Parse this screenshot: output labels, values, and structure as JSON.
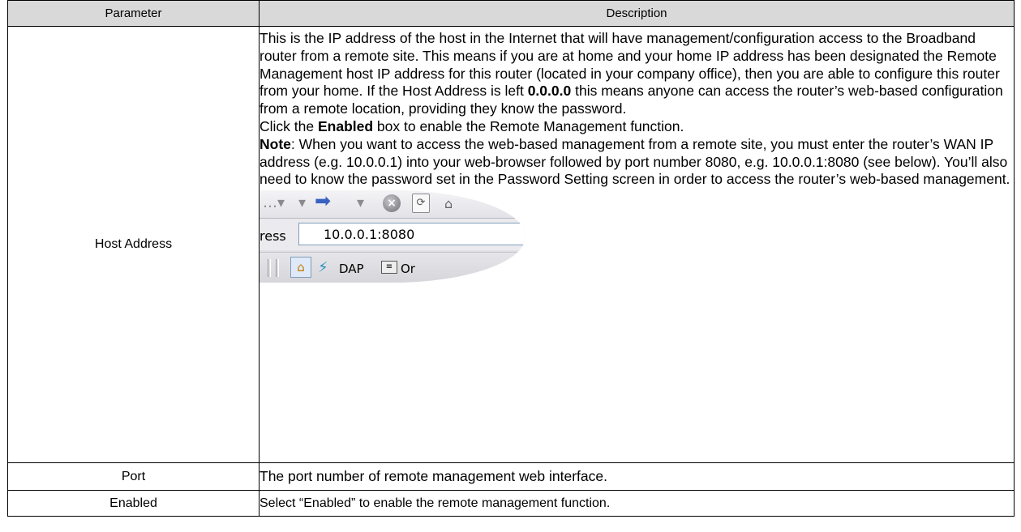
{
  "table": {
    "headers": {
      "parameter": "Parameter",
      "description": "Description"
    },
    "rows": {
      "host": {
        "name": "Host Address",
        "p1": "This is the IP address of the host in the Internet that will have management/configuration access to the Broadband router from a remote site. This means if you are at home and your home IP address has been designated the Remote Management host IP address for this router (located in your company office), then you are able to configure this router from your home. If the Host Address is left ",
        "p1_bold": "0.0.0.0",
        "p1_tail": " this means anyone can access the router’s web-based configuration from a remote location, providing they know the password.",
        "p2_pre": "Click the ",
        "p2_bold": "Enabled",
        "p2_tail": " box to enable the Remote Management function.",
        "p3_bold": "Note",
        "p3_tail": ": When you want to access the web-based management from a remote site, you must enter the router’s WAN IP address (e.g. 10.0.0.1) into your web-browser followed by port number 8080, e.g. 10.0.0.1:8080 (see below). You’ll also need to know the password set in the Password Setting screen in order to access the router’s web-based management."
      },
      "port": {
        "name": "Port",
        "desc": "The port number of remote management web interface."
      },
      "enabled": {
        "name": "Enabled",
        "desc": "Select “Enabled” to enable the remote management function."
      }
    }
  },
  "snippet": {
    "address_label": "ress",
    "address_value": "10.0.0.1:8080",
    "link1": "DAP",
    "link2": "Or",
    "icons": [
      "back-icon",
      "forward-arrow-icon",
      "stop-icon",
      "refresh-icon",
      "home-icon",
      "dap-icon",
      "options-icon"
    ]
  }
}
